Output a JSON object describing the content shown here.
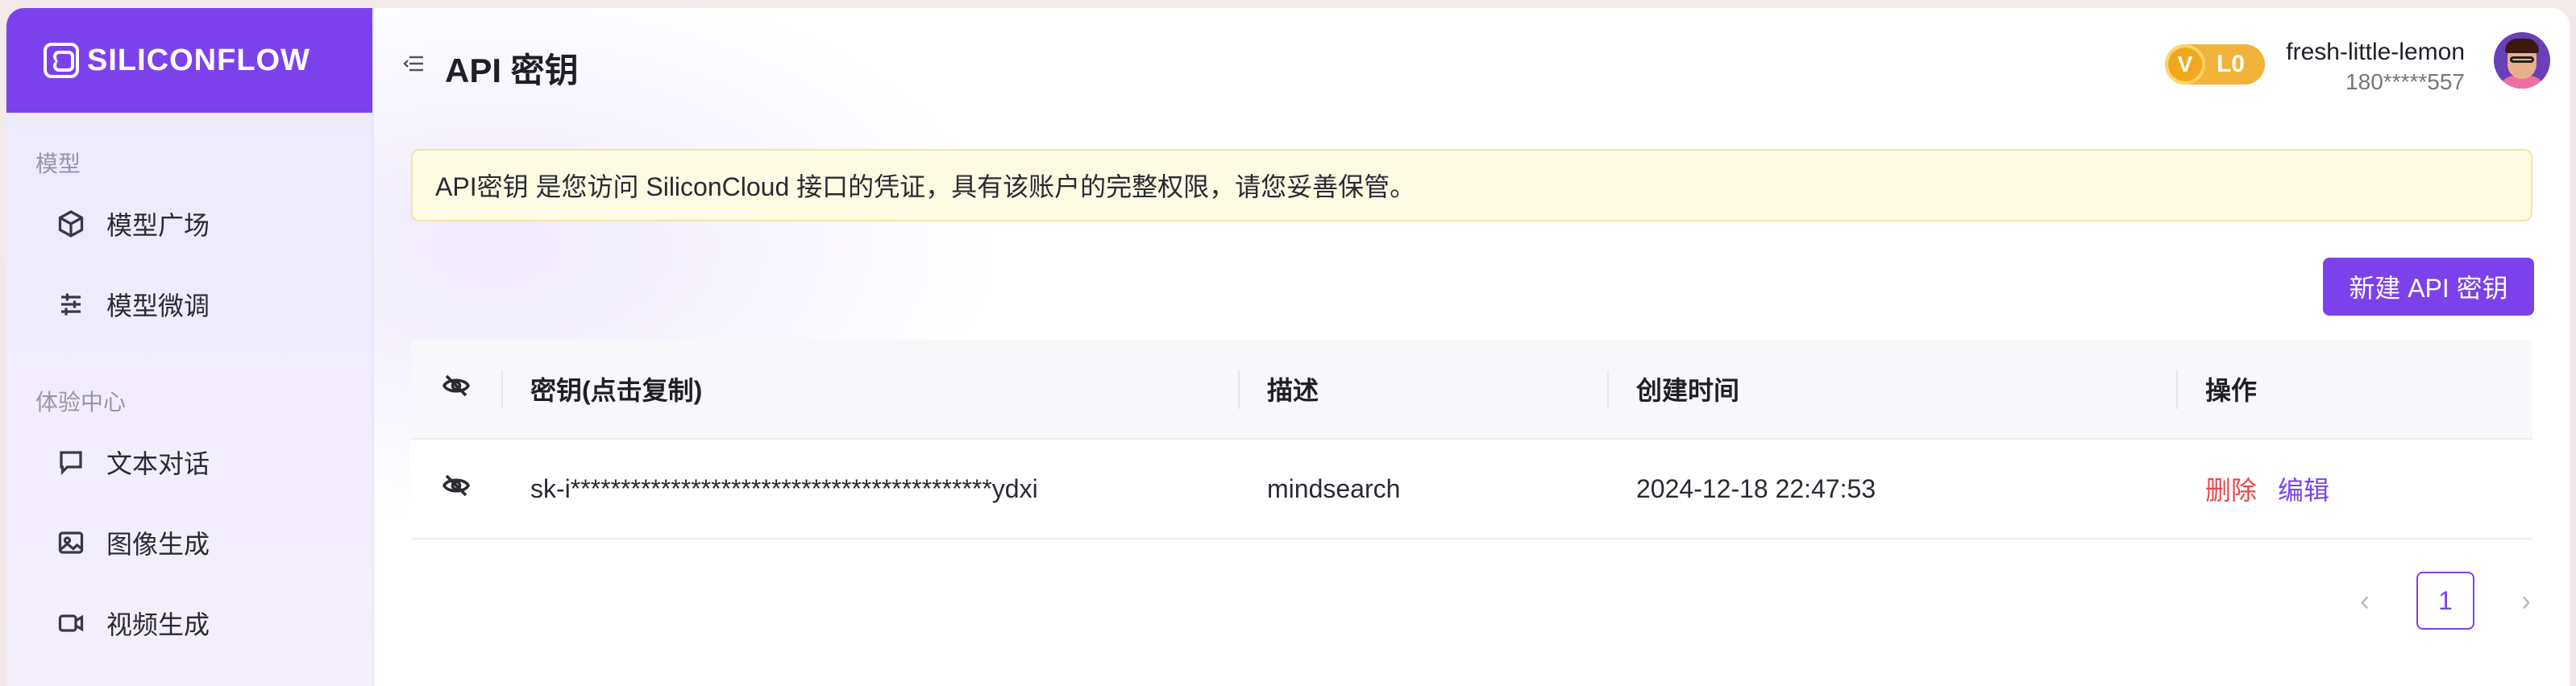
{
  "brand": {
    "name": "SILICONFLOW"
  },
  "sidebar": {
    "sections": [
      {
        "title": "模型",
        "items": [
          {
            "label": "模型广场",
            "icon": "cube-icon"
          },
          {
            "label": "模型微调",
            "icon": "sliders-icon"
          }
        ]
      },
      {
        "title": "体验中心",
        "items": [
          {
            "label": "文本对话",
            "icon": "chat-icon"
          },
          {
            "label": "图像生成",
            "icon": "image-icon"
          },
          {
            "label": "视频生成",
            "icon": "video-icon"
          }
        ]
      }
    ]
  },
  "header": {
    "title": "API 密钥",
    "level_badge": {
      "v": "V",
      "level": "L0"
    },
    "user": {
      "name": "fresh-little-lemon",
      "phone": "180*****557"
    }
  },
  "notice": "API密钥 是您访问 SiliconCloud 接口的凭证，具有该账户的完整权限，请您妥善保管。",
  "actions": {
    "new_key_label": "新建 API 密钥"
  },
  "table": {
    "columns": [
      "密钥(点击复制)",
      "描述",
      "创建时间",
      "操作"
    ],
    "rows": [
      {
        "key": "sk-i******************************************ydxi",
        "description": "mindsearch",
        "created": "2024-12-18 22:47:53",
        "delete_label": "删除",
        "edit_label": "编辑"
      }
    ]
  },
  "pagination": {
    "current": "1",
    "prev": "‹",
    "next": "›"
  },
  "colors": {
    "accent": "#7b42ec",
    "danger": "#e5484d",
    "badge": "#f2b33a"
  }
}
